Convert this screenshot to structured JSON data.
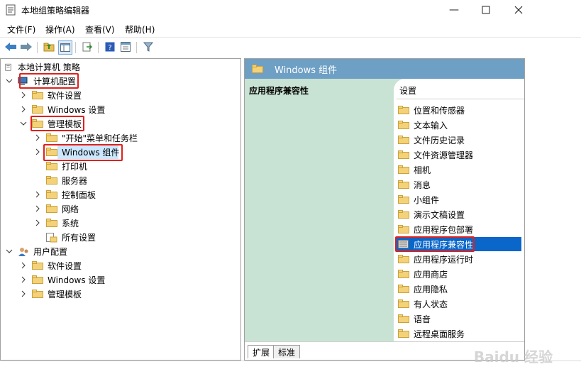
{
  "window": {
    "title": "本地组策略编辑器",
    "minimize_icon": "minimize-icon",
    "maximize_icon": "maximize-icon",
    "close_icon": "close-icon"
  },
  "menu": [
    {
      "label": "文件(F)"
    },
    {
      "label": "操作(A)"
    },
    {
      "label": "查看(V)"
    },
    {
      "label": "帮助(H)"
    }
  ],
  "toolbar": {
    "icons": [
      "back-arrow-icon",
      "forward-arrow-icon",
      "up-folder-icon",
      "show-hide-tree-icon",
      "export-list-icon",
      "help-icon",
      "properties-icon",
      "filter-icon"
    ]
  },
  "tree": {
    "root": "本地计算机 策略",
    "computer_config": "计算机配置",
    "software_settings": "软件设置",
    "windows_settings": "Windows 设置",
    "admin_templates": "管理模板",
    "start_menu": "\"开始\"菜单和任务栏",
    "windows_components": "Windows 组件",
    "printers": "打印机",
    "server": "服务器",
    "control_panel": "控制面板",
    "network": "网络",
    "system": "系统",
    "all_settings": "所有设置",
    "user_config": "用户配置",
    "user_software_settings": "软件设置",
    "user_windows_settings": "Windows 设置",
    "user_admin_templates": "管理模板"
  },
  "right": {
    "header_title": "Windows 组件",
    "selected_title": "应用程序兼容性",
    "list_header": "设置",
    "items": [
      {
        "label": "位置和传感器"
      },
      {
        "label": "文本输入"
      },
      {
        "label": "文件历史记录"
      },
      {
        "label": "文件资源管理器"
      },
      {
        "label": "相机"
      },
      {
        "label": "消息"
      },
      {
        "label": "小组件"
      },
      {
        "label": "演示文稿设置"
      },
      {
        "label": "应用程序包部署"
      },
      {
        "label": "应用程序兼容性"
      },
      {
        "label": "应用程序运行时"
      },
      {
        "label": "应用商店"
      },
      {
        "label": "应用隐私"
      },
      {
        "label": "有人状态"
      },
      {
        "label": "语音"
      },
      {
        "label": "远程桌面服务"
      }
    ],
    "tabs": [
      {
        "label": "扩展"
      },
      {
        "label": "标准"
      }
    ]
  },
  "colors": {
    "selection": "#0a66c8",
    "highlight_box": "#e0201c",
    "header": "#6e9fc4",
    "pane_bg": "#c8e3d3"
  },
  "watermark": "Baidu 经验"
}
